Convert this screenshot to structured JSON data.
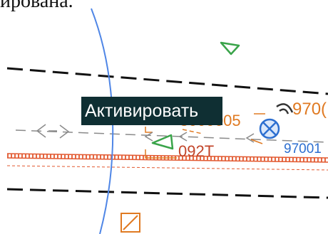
{
  "header": {
    "partial_text": "ирована."
  },
  "map": {
    "labels": {
      "code_center": "3000005",
      "code_left": "092T",
      "code_right_top": "970(",
      "code_right_blue": "97001"
    },
    "colors": {
      "route_line": "#111111",
      "rail": "#e2582f",
      "boundary": "#4f86e6",
      "triangle": "#3aa44a",
      "orange_feature": "#e07a22",
      "blue_feature": "#2d6fd0",
      "grey_dash": "#8a8a8a"
    },
    "icons": {
      "triangle": "triangle-marker-icon",
      "crossed_circle": "crossed-circle-icon",
      "signal": "signal-arcs-icon",
      "square_diagonal": "square-diagonal-icon",
      "arrow_left": "arrow-left-icon",
      "arrow_right": "arrow-right-icon"
    }
  },
  "tooltip": {
    "label": "Активировать"
  }
}
